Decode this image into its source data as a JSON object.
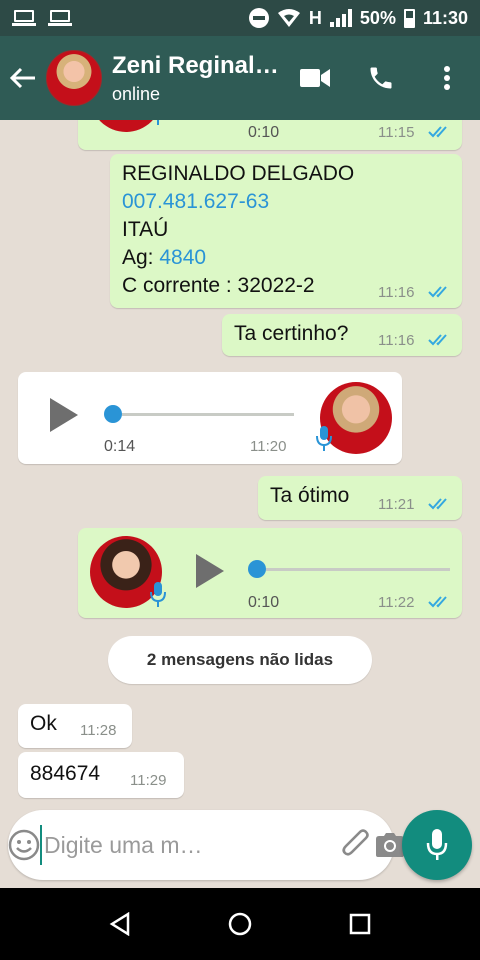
{
  "status_bar": {
    "network": "H",
    "battery": "50%",
    "time": "11:30"
  },
  "header": {
    "contact_name": "Zeni Reginal…",
    "status": "online",
    "icons": [
      "back-arrow-icon",
      "video-call-icon",
      "phone-icon",
      "more-vert-icon"
    ]
  },
  "messages": [
    {
      "kind": "voice",
      "direction": "out",
      "duration": "0:10",
      "time": "11:15",
      "ticks": "read"
    },
    {
      "kind": "text",
      "direction": "out",
      "lines": [
        "REGINALDO DELGADO",
        "007.481.627-63",
        "ITAÚ",
        "Ag: ",
        "4840",
        "C corrente : 32022-2"
      ],
      "time": "11:16",
      "ticks": "read"
    },
    {
      "kind": "text",
      "direction": "out",
      "text": "Ta certinho?",
      "time": "11:16",
      "ticks": "read"
    },
    {
      "kind": "voice",
      "direction": "in",
      "duration": "0:14",
      "time": "11:20"
    },
    {
      "kind": "text",
      "direction": "out",
      "text": "Ta ótimo",
      "time": "11:21",
      "ticks": "read"
    },
    {
      "kind": "voice",
      "direction": "out",
      "duration": "0:10",
      "time": "11:22",
      "ticks": "read"
    },
    {
      "kind": "text",
      "direction": "in",
      "text": "Ok",
      "time": "11:28"
    },
    {
      "kind": "text",
      "direction": "in",
      "text": "884674",
      "time": "11:29"
    }
  ],
  "unread_banner": "2 mensagens não lidas",
  "composer": {
    "placeholder": "Digite uma m…",
    "icons": [
      "emoji-icon",
      "attach-icon",
      "camera-icon",
      "mic-icon"
    ]
  },
  "colors": {
    "header": "#2f5b55",
    "outgoing_bubble": "#dcf8c6",
    "incoming_bubble": "#ffffff",
    "chat_background": "#e5ddd5",
    "accent": "#128c7e",
    "link": "#2a94d6"
  }
}
